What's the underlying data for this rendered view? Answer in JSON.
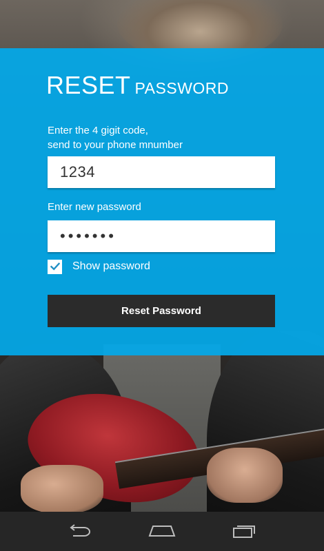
{
  "screen": {
    "title_large": "RESET",
    "title_small": "PASSWORD"
  },
  "form": {
    "code_label_line1": "Enter the 4 gigit code,",
    "code_label_line2": "send to your phone mnumber",
    "code_value": "1234",
    "password_label": "Enter new password",
    "password_masked": "•••••••",
    "show_password_label": "Show password",
    "show_password_checked": true,
    "submit_label": "Reset Password"
  },
  "navbar": {
    "back_icon": "back-icon",
    "home_icon": "home-icon",
    "recents_icon": "recent-apps-icon"
  },
  "colors": {
    "panel_blue": "#03A9E9",
    "button_dark": "#2B2B2B",
    "navbar": "#262626"
  }
}
